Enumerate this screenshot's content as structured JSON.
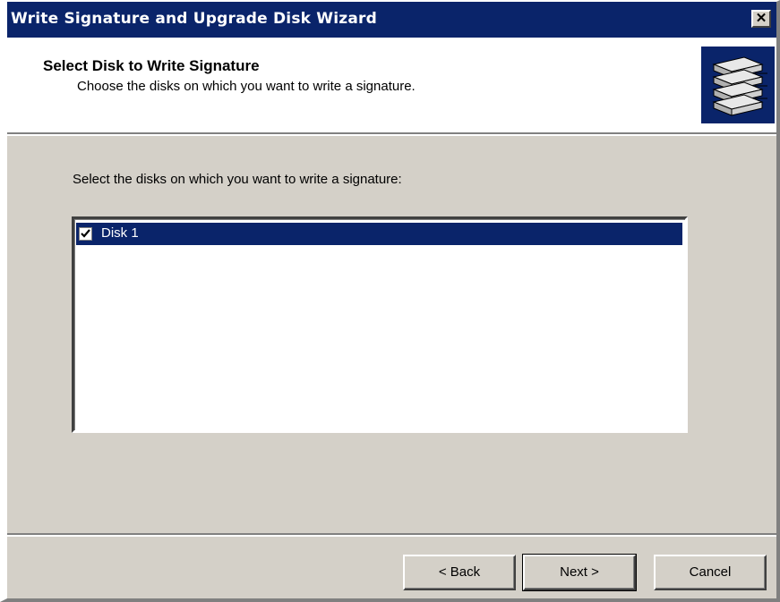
{
  "window": {
    "title": "Write Signature and Upgrade Disk Wizard",
    "close_glyph": "✕"
  },
  "header": {
    "title": "Select Disk to Write Signature",
    "subtitle": "Choose the disks on which you want to write a signature.",
    "icon": "disk-stack-icon"
  },
  "body": {
    "instruction": "Select the disks on which you want to write a signature:",
    "disks": [
      {
        "label": "Disk 1",
        "checked": true,
        "selected": true
      }
    ]
  },
  "buttons": {
    "back_label": "< Back",
    "next_label": "Next >",
    "cancel_label": "Cancel"
  },
  "colors": {
    "titlebar": "#0a246a",
    "face": "#d4d0c8",
    "selection": "#0a246a"
  }
}
